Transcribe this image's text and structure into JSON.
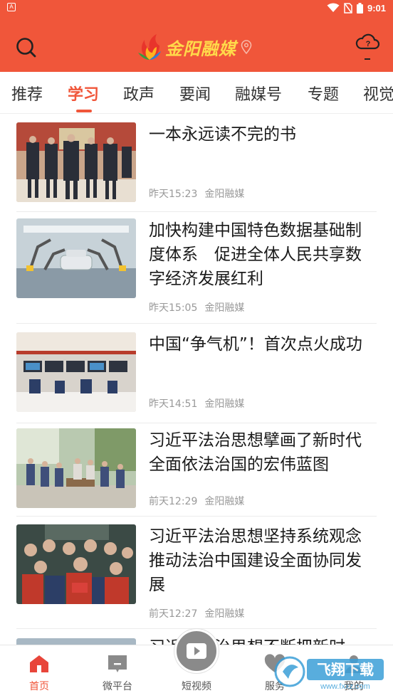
{
  "status_bar": {
    "left_icon": "A",
    "time": "9:01",
    "icons": [
      "wifi-icon",
      "no-sim-icon",
      "battery-icon"
    ]
  },
  "header": {
    "app_name": "金阳融媒",
    "search_icon": "search-icon",
    "location_icon": "location-pin-icon",
    "weather_icon": "cloud-question-icon",
    "weather_text": "?",
    "weather_temp": "-",
    "colors": {
      "brand": "#f0563a",
      "logo_text": "#ffd94a"
    }
  },
  "tabs": [
    {
      "label": "推荐",
      "active": false
    },
    {
      "label": "学习",
      "active": true
    },
    {
      "label": "政声",
      "active": false
    },
    {
      "label": "要闻",
      "active": false
    },
    {
      "label": "融媒号",
      "active": false
    },
    {
      "label": "专题",
      "active": false
    },
    {
      "label": "视觉",
      "active": false
    }
  ],
  "feed": [
    {
      "title": "一本永远读不完的书",
      "time": "昨天15:23",
      "source": "金阳融媒"
    },
    {
      "title": "加快构建中国特色数据基础制度体系　促进全体人民共享数字经济发展红利",
      "time": "昨天15:05",
      "source": "金阳融媒"
    },
    {
      "title": "中国“争气机”！首次点火成功",
      "time": "昨天14:51",
      "source": "金阳融媒"
    },
    {
      "title": "习近平法治思想擘画了新时代全面依法治国的宏伟蓝图",
      "time": "前天12:29",
      "source": "金阳融媒"
    },
    {
      "title": "习近平法治思想坚持系统观念推动法治中国建设全面协同发展",
      "time": "前天12:27",
      "source": "金阳融媒"
    },
    {
      "title": "习近平法治思想不断把新时",
      "time": "",
      "source": ""
    }
  ],
  "bottom_nav": [
    {
      "label": "首页",
      "icon": "home-icon",
      "active": true
    },
    {
      "label": "微平台",
      "icon": "chat-board-icon",
      "active": false
    },
    {
      "label": "短视频",
      "icon": "video-camera-icon",
      "active": false
    },
    {
      "label": "服务",
      "icon": "heart-service-icon",
      "active": false
    },
    {
      "label": "我的",
      "icon": "user-icon",
      "active": false
    }
  ],
  "watermark": {
    "text": "飞翔下载",
    "sub": "www.fxxz.com"
  }
}
